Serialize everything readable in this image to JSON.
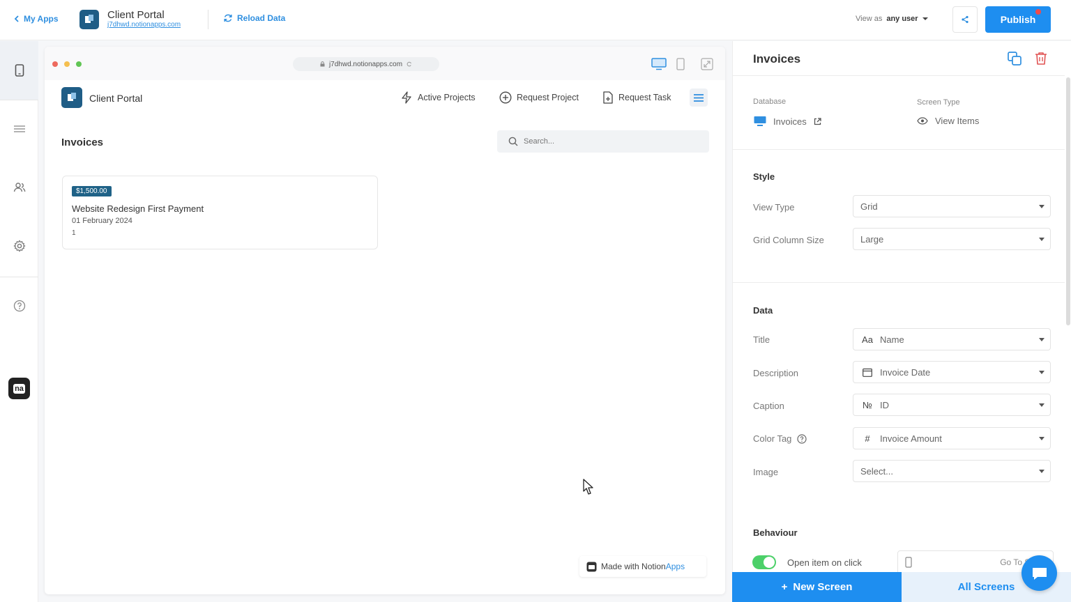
{
  "topbar": {
    "back_label": "My Apps",
    "app_title": "Client Portal",
    "app_url": "j7dhwd.notionapps.com",
    "reload_label": "Reload Data",
    "view_as_prefix": "View as",
    "view_as_value": "any user",
    "publish_label": "Publish"
  },
  "preview": {
    "browser_url": "j7dhwd.notionapps.com",
    "site_title": "Client Portal",
    "nav": [
      "Active Projects",
      "Request Project",
      "Request Task"
    ],
    "page_title": "Invoices",
    "search_placeholder": "Search...",
    "card": {
      "tag": "$1,500.00",
      "title": "Website Redesign First Payment",
      "description": "01 February 2024",
      "caption": "1"
    },
    "made_with_prefix": "Made with Notion",
    "made_with_accent": "Apps"
  },
  "panel": {
    "title": "Invoices",
    "database_label": "Database",
    "database_value": "Invoices",
    "screen_type_label": "Screen Type",
    "screen_type_value": "View Items",
    "style_heading": "Style",
    "view_type_label": "View Type",
    "view_type_value": "Grid",
    "grid_size_label": "Grid Column Size",
    "grid_size_value": "Large",
    "data_heading": "Data",
    "title_label": "Title",
    "title_icon": "Aa",
    "title_value": "Name",
    "description_label": "Description",
    "description_value": "Invoice Date",
    "caption_label": "Caption",
    "caption_icon": "№",
    "caption_value": "ID",
    "color_tag_label": "Color Tag",
    "color_tag_icon": "#",
    "color_tag_value": "Invoice Amount",
    "image_label": "Image",
    "image_value": "Select...",
    "behaviour_heading": "Behaviour",
    "open_item_label": "Open item on click",
    "goto_value": "Go To Scre"
  },
  "bottom": {
    "new_screen_label": "New Screen",
    "all_screens_label": "All Screens"
  },
  "colors": {
    "accent": "#1e8ef0",
    "brand_dark": "#1f5d86",
    "toggle_on": "#4cd069",
    "badge": "#f04b4b"
  }
}
